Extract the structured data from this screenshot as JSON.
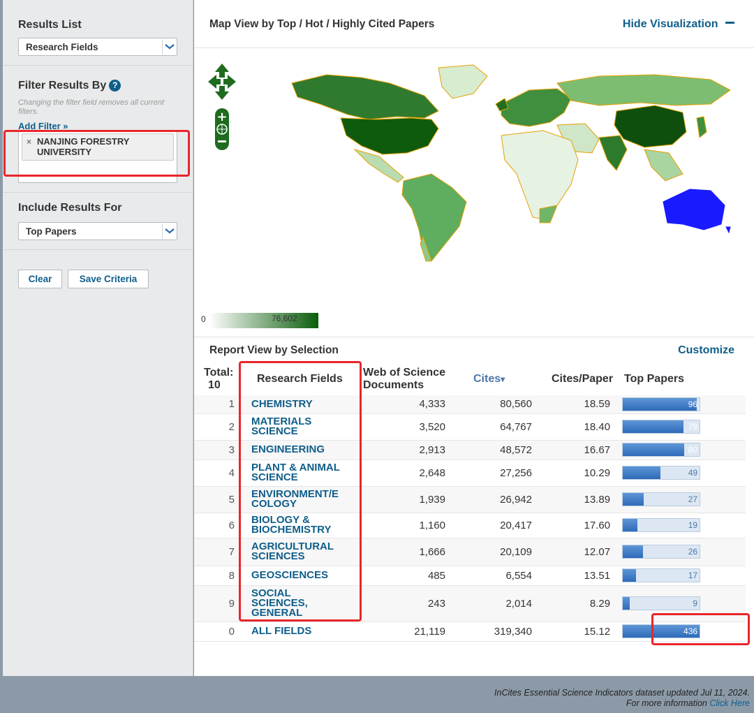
{
  "left": {
    "results_list": {
      "title": "Results List",
      "selected": "Research Fields"
    },
    "filter": {
      "title": "Filter Results By",
      "help": "?",
      "hint": "Changing the filter field removes all current filters.",
      "add_filter": "Add Filter »",
      "chip_remove": "×",
      "chip": "NANJING FORESTRY UNIVERSITY"
    },
    "include": {
      "title": "Include Results For",
      "selected": "Top Papers"
    },
    "buttons": {
      "clear": "Clear",
      "save": "Save Criteria"
    }
  },
  "map": {
    "title": "Map View by Top / Hot / Highly Cited Papers",
    "hide_link": "Hide Visualization",
    "legend_min": "0",
    "legend_max": "76,602",
    "colors": {
      "low": "#ffffff",
      "high": "#0b5d0b",
      "highlight": "#1a1aff"
    }
  },
  "report": {
    "title": "Report View by Selection",
    "customize": "Customize",
    "headers": {
      "total": "Total:",
      "total_n": "10",
      "field": "Research Fields",
      "docs": "Web of Science Documents",
      "cites": "Cites",
      "cites_sort": "▾",
      "cpp": "Cites/Paper",
      "top": "Top Papers"
    },
    "rows": [
      {
        "rank": "1",
        "field": "CHEMISTRY",
        "docs": "4,333",
        "cites": "80,560",
        "cpp": "18.59",
        "top": "96",
        "top_value": 96
      },
      {
        "rank": "2",
        "field": "MATERIALS SCIENCE",
        "docs": "3,520",
        "cites": "64,767",
        "cpp": "18.40",
        "top": "79",
        "top_value": 79
      },
      {
        "rank": "3",
        "field": "ENGINEERING",
        "docs": "2,913",
        "cites": "48,572",
        "cpp": "16.67",
        "top": "80",
        "top_value": 80
      },
      {
        "rank": "4",
        "field": "PLANT & ANIMAL SCIENCE",
        "docs": "2,648",
        "cites": "27,256",
        "cpp": "10.29",
        "top": "49",
        "top_value": 49
      },
      {
        "rank": "5",
        "field": "ENVIRONMENT/E COLOGY",
        "docs": "1,939",
        "cites": "26,942",
        "cpp": "13.89",
        "top": "27",
        "top_value": 27
      },
      {
        "rank": "6",
        "field": "BIOLOGY & BIOCHEMISTRY",
        "docs": "1,160",
        "cites": "20,417",
        "cpp": "17.60",
        "top": "19",
        "top_value": 19
      },
      {
        "rank": "7",
        "field": "AGRICULTURAL SCIENCES",
        "docs": "1,666",
        "cites": "20,109",
        "cpp": "12.07",
        "top": "26",
        "top_value": 26
      },
      {
        "rank": "8",
        "field": "GEOSCIENCES",
        "docs": "485",
        "cites": "6,554",
        "cpp": "13.51",
        "top": "17",
        "top_value": 17
      },
      {
        "rank": "9",
        "field": "SOCIAL SCIENCES, GENERAL",
        "docs": "243",
        "cites": "2,014",
        "cpp": "8.29",
        "top": "9",
        "top_value": 9
      },
      {
        "rank": "0",
        "field": "ALL FIELDS",
        "docs": "21,119",
        "cites": "319,340",
        "cpp": "15.12",
        "top": "436",
        "top_value": 436
      }
    ],
    "bar_max": 100
  },
  "footer": {
    "line1": "InCites Essential Science Indicators dataset updated Jul 11, 2024.",
    "line2_prefix": "For more information ",
    "line2_link": "Click Here"
  }
}
